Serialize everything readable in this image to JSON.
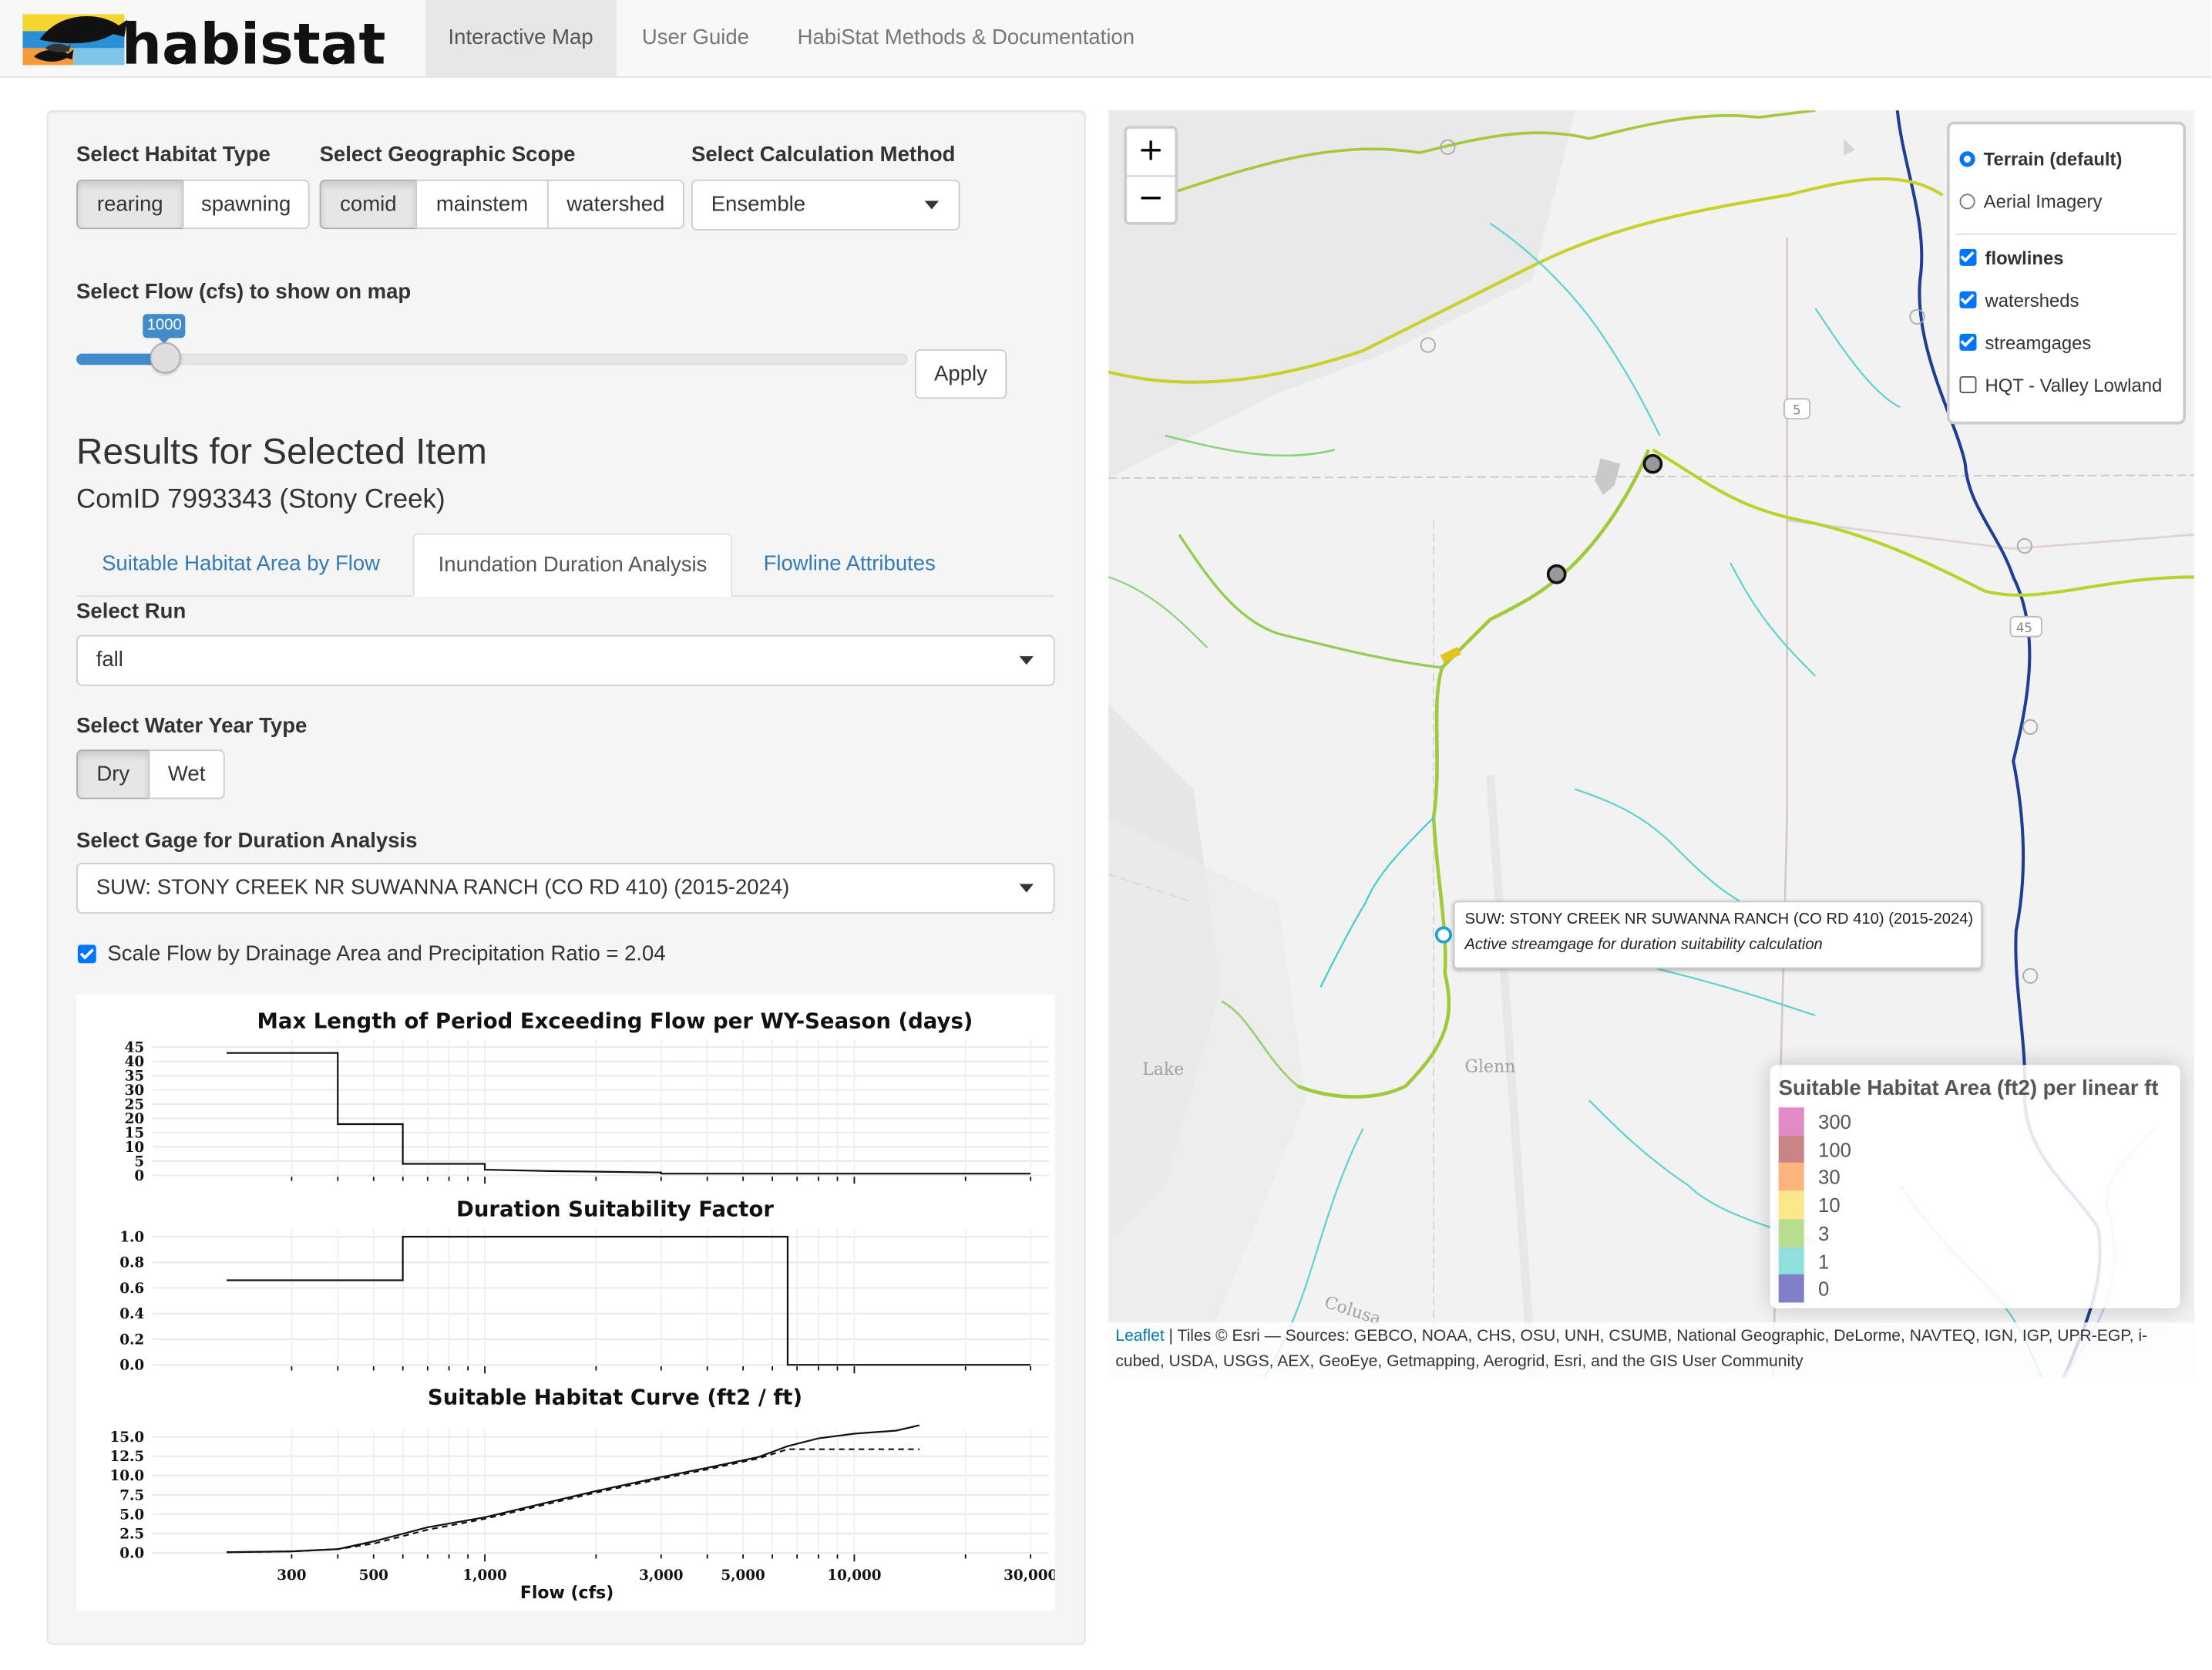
{
  "brand": {
    "name": "habistat"
  },
  "nav": {
    "tabs": [
      {
        "label": "Interactive Map"
      },
      {
        "label": "User Guide"
      },
      {
        "label": "HabiStat Methods & Documentation"
      }
    ]
  },
  "sidebar": {
    "habitat_type": {
      "label": "Select Habitat Type",
      "options": [
        "rearing",
        "spawning"
      ],
      "selected": "rearing"
    },
    "geographic_scope": {
      "label": "Select Geographic Scope",
      "options": [
        "comid",
        "mainstem",
        "watershed"
      ],
      "selected": "comid"
    },
    "calc_method": {
      "label": "Select Calculation Method",
      "value": "Ensemble"
    },
    "flow": {
      "label": "Select Flow (cfs) to show on map",
      "value": "1000",
      "fraction": 0.028,
      "apply_label": "Apply"
    },
    "results": {
      "heading": "Results for Selected Item",
      "subheading": "ComID 7993343 (Stony Creek)"
    },
    "tabs": [
      {
        "label": "Suitable Habitat Area by Flow"
      },
      {
        "label": "Inundation Duration Analysis"
      },
      {
        "label": "Flowline Attributes"
      }
    ],
    "run": {
      "label": "Select Run",
      "value": "fall"
    },
    "water_year": {
      "label": "Select Water Year Type",
      "options": [
        "Dry",
        "Wet"
      ],
      "selected": "Dry"
    },
    "gage": {
      "label": "Select Gage for Duration Analysis",
      "value": "SUW: STONY CREEK NR SUWANNA RANCH (CO RD 410) (2015-2024)"
    },
    "scale_flow": {
      "label": "Scale Flow by Drainage Area and Precipitation Ratio = 2.04",
      "checked": true
    }
  },
  "chart_data": [
    {
      "type": "line",
      "title": "Max Length of Period Exceeding Flow per WY-Season (days)",
      "x_scale": "log",
      "xlim": [
        200,
        30000
      ],
      "ylim": [
        0,
        45
      ],
      "yticks": [
        "0",
        "5",
        "10",
        "15",
        "20",
        "25",
        "30",
        "35",
        "40",
        "45"
      ],
      "series": [
        {
          "x": [
            200,
            400,
            400,
            600,
            600,
            1000,
            1000,
            1500,
            3000,
            3000,
            30000
          ],
          "y": [
            43,
            43,
            18,
            18,
            4,
            4,
            2,
            1.5,
            1,
            0.6,
            0.6
          ]
        }
      ]
    },
    {
      "type": "line",
      "title": "Duration Suitability Factor",
      "x_scale": "log",
      "xlim": [
        200,
        30000
      ],
      "ylim": [
        0,
        1
      ],
      "yticks": [
        "0.0",
        "0.2",
        "0.4",
        "0.6",
        "0.8",
        "1.0"
      ],
      "series": [
        {
          "x": [
            200,
            600,
            600,
            6600,
            6600,
            30000
          ],
          "y": [
            0.66,
            0.66,
            1.0,
            1.0,
            0.0,
            0.0
          ]
        }
      ]
    },
    {
      "type": "line",
      "title": "Suitable Habitat Curve (ft2 / ft)",
      "xlabel": "Flow (cfs)",
      "x_scale": "log",
      "xlim": [
        200,
        30000
      ],
      "ylim": [
        0,
        15
      ],
      "xticks": [
        "300",
        "500",
        "1,000",
        "3,000",
        "5,000",
        "10,000",
        "30,000"
      ],
      "yticks": [
        "0.0",
        "2.5",
        "5.0",
        "7.5",
        "10.0",
        "12.5",
        "15.0"
      ],
      "series": [
        {
          "style": "solid",
          "x": [
            200,
            300,
            400,
            500,
            700,
            1000,
            1500,
            2000,
            3000,
            4000,
            5500,
            6600,
            8000,
            10000,
            13000,
            15000
          ],
          "y": [
            0.1,
            0.2,
            0.5,
            1.5,
            3.3,
            4.6,
            6.6,
            8.0,
            9.8,
            11.0,
            12.4,
            13.8,
            14.8,
            15.4,
            15.8,
            16.5
          ]
        },
        {
          "style": "dashed",
          "x": [
            200,
            300,
            400,
            500,
            700,
            1000,
            1500,
            2000,
            3000,
            4000,
            5500,
            6600,
            8000,
            10000,
            13000,
            15000
          ],
          "y": [
            0.1,
            0.2,
            0.5,
            1.2,
            3.0,
            4.4,
            6.4,
            7.8,
            9.6,
            10.8,
            12.2,
            13.4,
            13.4,
            13.4,
            13.4,
            13.4
          ]
        }
      ]
    }
  ],
  "map": {
    "zoom_in": "+",
    "zoom_out": "−",
    "layers": {
      "base": [
        {
          "label": "Terrain (default)",
          "selected": true
        },
        {
          "label": "Aerial Imagery",
          "selected": false
        }
      ],
      "overlays": [
        {
          "label": "flowlines",
          "checked": true
        },
        {
          "label": "watersheds",
          "checked": true
        },
        {
          "label": "streamgages",
          "checked": true
        },
        {
          "label": "HQT - Valley Lowland",
          "checked": false
        }
      ]
    },
    "tooltip": {
      "title": "SUW: STONY CREEK NR SUWANNA RANCH (CO RD 410) (2015-2024)",
      "subtitle": "Active streamgage for duration suitability calculation"
    },
    "place_labels": [
      "Lake",
      "Glenn",
      "Colusa",
      "5",
      "45"
    ],
    "legend": {
      "title": "Suitable Habitat Area (ft2) per linear ft",
      "items": [
        {
          "label": "300",
          "color": "#e08bc6"
        },
        {
          "label": "100",
          "color": "#c98585"
        },
        {
          "label": "30",
          "color": "#fbb57c"
        },
        {
          "label": "10",
          "color": "#fbe88a"
        },
        {
          "label": "3",
          "color": "#b9dd8f"
        },
        {
          "label": "1",
          "color": "#8fe0dc"
        },
        {
          "label": "0",
          "color": "#8080c8"
        }
      ]
    },
    "attribution": {
      "leaflet": "Leaflet",
      "text": " | Tiles © Esri — Sources: GEBCO, NOAA, CHS, OSU, UNH, CSUMB, National Geographic, DeLorme, NAVTEQ, IGN, IGP, UPR-EGP, i-cubed, USDA, USGS, AEX, GeoEye, Getmapping, Aerogrid, Esri, and the GIS User Community"
    }
  }
}
